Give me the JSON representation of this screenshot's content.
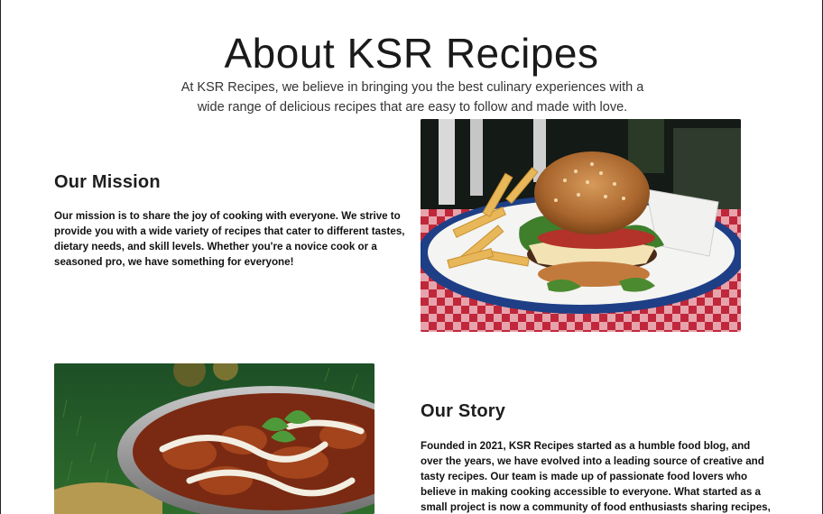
{
  "page": {
    "title": "About KSR Recipes",
    "intro": "At KSR Recipes, we believe in bringing you the best culinary experiences with a wide range of delicious recipes that are easy to follow and made with love."
  },
  "mission": {
    "heading": "Our Mission",
    "text": "Our mission is to share the joy of cooking with everyone. We strive to provide you with a wide variety of recipes that cater to different tastes, dietary needs, and skill levels. Whether you're a novice cook or a seasoned pro, we have something for everyone!"
  },
  "story": {
    "heading": "Our Story",
    "text": "Founded in 2021, KSR Recipes started as a humble food blog, and over the years, we have evolved into a leading source of creative and tasty recipes. Our team is made up of passionate food lovers who believe in making cooking accessible to everyone. What started as a small project is now a community of food enthusiasts sharing recipes, tips, and"
  },
  "images": {
    "burger": "burger-with-fries-photo",
    "curry": "curry-bowl-photo"
  },
  "colors": {
    "background": "#ffffff",
    "text": "#1f1f1f",
    "checkered_red": "#c0273a",
    "plate_blue": "#1e3f86"
  }
}
